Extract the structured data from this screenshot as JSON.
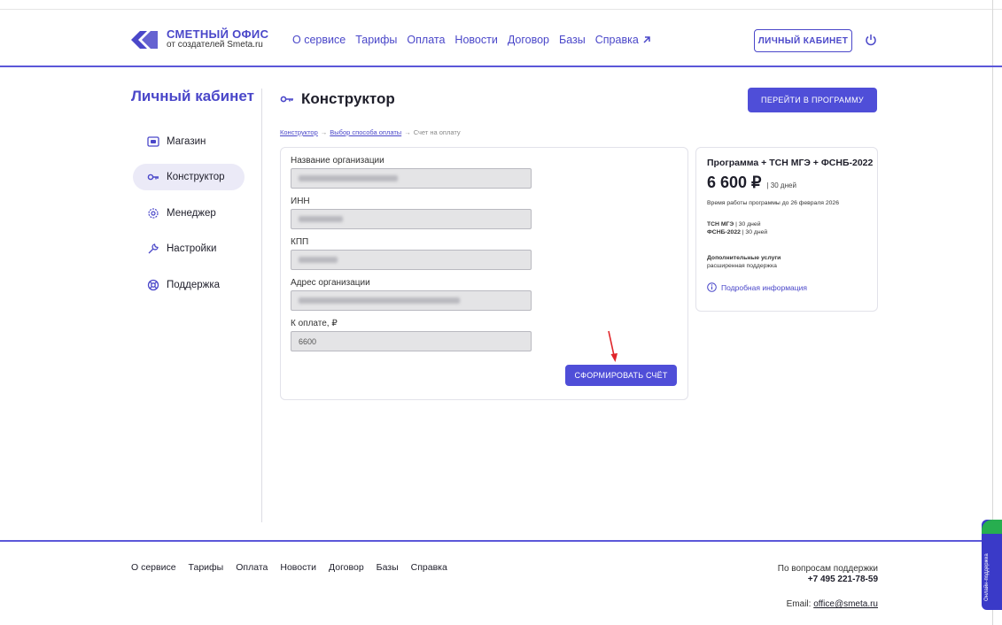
{
  "header": {
    "logo_title": "СМЕТНЫЙ ОФИС",
    "logo_subtitle": "от создателей Smeta.ru",
    "nav": [
      "О сервисе",
      "Тарифы",
      "Оплата",
      "Новости",
      "Договор",
      "Базы",
      "Справка"
    ],
    "cabinet_button": "ЛИЧНЫЙ КАБИНЕТ",
    "accent_color": "#4a47c9"
  },
  "sidebar": {
    "title": "Личный кабинет",
    "items": [
      {
        "label": "Магазин",
        "icon": "shop-icon"
      },
      {
        "label": "Конструктор",
        "icon": "key-icon",
        "active": true
      },
      {
        "label": "Менеджер",
        "icon": "gear-icon"
      },
      {
        "label": "Настройки",
        "icon": "wrench-icon"
      },
      {
        "label": "Поддержка",
        "icon": "lifebuoy-icon"
      }
    ]
  },
  "main": {
    "title": "Конструктор",
    "go_button": "ПЕРЕЙТИ В ПРОГРАММУ",
    "breadcrumb": {
      "step1": "Конструктор",
      "step2": "Выбор способа оплаты",
      "step3": "Счет на оплату",
      "separator": "→"
    },
    "form": {
      "org_name_label": "Название организации",
      "inn_label": "ИНН",
      "kpp_label": "КПП",
      "address_label": "Адрес организации",
      "amount_label": "К оплате, ₽",
      "amount_value": "6600",
      "submit_button": "СФОРМИРОВАТЬ СЧЁТ"
    }
  },
  "info": {
    "title": "Программа + ТСН МГЭ + ФСНБ-2022",
    "price": "6 600 ₽",
    "period": "| 30 дней",
    "valid_until": "Время работы программы до 26 февраля 2026",
    "base1_name": "ТСН МГЭ",
    "base1_period": "| 30 дней",
    "base2_name": "ФСНБ-2022",
    "base2_period": "| 30 дней",
    "extra_title": "Дополнительные услуги",
    "extra_value": "расширенная поддержка",
    "more_link": "Подробная информация"
  },
  "footer": {
    "nav": [
      "О сервисе",
      "Тарифы",
      "Оплата",
      "Новости",
      "Договор",
      "Базы",
      "Справка"
    ],
    "support_label": "По вопросам поддержки",
    "support_phone": "+7 495 221-78-59",
    "email_label": "Email:",
    "email": "office@smeta.ru",
    "online_tab": "Онлайн-поддержка"
  }
}
